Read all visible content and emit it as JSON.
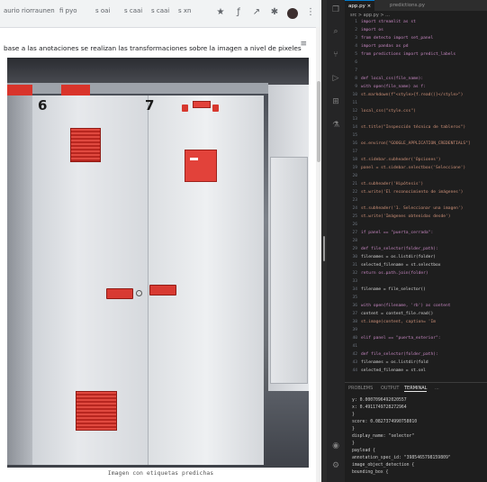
{
  "browser": {
    "bookmarks": [
      "aurio riorraunen",
      "fi pyo",
      "s oai",
      "s caai",
      "s caai",
      "s xn"
    ],
    "toolbar_icons": [
      "star-icon",
      "edit-icon",
      "pen-icon",
      "puzzle-icon",
      "avatar",
      "menu-icon"
    ],
    "description": "base a las anotaciones se realizan las transformaciones sobre la imagen a nivel de pixeles",
    "photo": {
      "label_left": "6",
      "label_right": "7",
      "colors": {
        "cabinet": "#e3e6e9",
        "accent": "#e2423a"
      }
    },
    "caption": "Imagen con etiquetas predichas"
  },
  "vscode": {
    "tabs": [
      "app.py",
      "predictions.py"
    ],
    "breadcrumb": "src > app.py > ...",
    "code_lines": [
      {
        "n": "1",
        "t": "import streamlit as st"
      },
      {
        "n": "2",
        "t": "import os"
      },
      {
        "n": "3",
        "t": "from detecto import set_panel"
      },
      {
        "n": "4",
        "t": "import pandas as pd"
      },
      {
        "n": "5",
        "t": "from predictions import predict_labels"
      },
      {
        "n": "6",
        "t": ""
      },
      {
        "n": "7",
        "t": ""
      },
      {
        "n": "8",
        "t": "def local_css(file_name):"
      },
      {
        "n": "9",
        "t": "    with open(file_name) as f:"
      },
      {
        "n": "10",
        "t": "        st.markdown(f\"<style>{f.read()}</style>\")"
      },
      {
        "n": "11",
        "t": ""
      },
      {
        "n": "12",
        "t": "local_css(\"style.css\")"
      },
      {
        "n": "13",
        "t": ""
      },
      {
        "n": "14",
        "t": "st.title(\"Inspección técnica de tableros\")"
      },
      {
        "n": "15",
        "t": ""
      },
      {
        "n": "16",
        "t": "os.environ[\"GOOGLE_APPLICATION_CREDENTIALS\"]"
      },
      {
        "n": "17",
        "t": ""
      },
      {
        "n": "18",
        "t": "st.sidebar.subheader('Opciones')"
      },
      {
        "n": "19",
        "t": "panel = st.sidebar.selectbox('Seleccione')"
      },
      {
        "n": "20",
        "t": ""
      },
      {
        "n": "21",
        "t": "st.subheader('Hipótesis')"
      },
      {
        "n": "22",
        "t": "st.write('El reconocimiento de imágenes')"
      },
      {
        "n": "23",
        "t": ""
      },
      {
        "n": "24",
        "t": "st.subheader('1. Seleccionar una imagen')"
      },
      {
        "n": "25",
        "t": "st.write('Imágenes obtenidas desde')"
      },
      {
        "n": "26",
        "t": ""
      },
      {
        "n": "27",
        "t": "if panel == \"puerta_cerrada\":"
      },
      {
        "n": "28",
        "t": ""
      },
      {
        "n": "29",
        "t": "    def file_selector(folder_path):"
      },
      {
        "n": "30",
        "t": "        filenames = os.listdir(folder)"
      },
      {
        "n": "31",
        "t": "        selected_filename = st.selectbox"
      },
      {
        "n": "32",
        "t": "        return os.path.join(folder)"
      },
      {
        "n": "33",
        "t": ""
      },
      {
        "n": "34",
        "t": "    filename = file_selector()"
      },
      {
        "n": "35",
        "t": ""
      },
      {
        "n": "36",
        "t": "    with open(filename, 'rb') as content"
      },
      {
        "n": "37",
        "t": "        content = content_file.read()"
      },
      {
        "n": "38",
        "t": "    st.image(content, caption= 'Im"
      },
      {
        "n": "39",
        "t": ""
      },
      {
        "n": "40",
        "t": "elif panel == \"puerta_exterior\":"
      },
      {
        "n": "41",
        "t": ""
      },
      {
        "n": "42",
        "t": "    def file_selector(folder_path):"
      },
      {
        "n": "43",
        "t": "        filenames = os.listdir(fold"
      },
      {
        "n": "44",
        "t": "        selected_filename = st.sel"
      }
    ],
    "panel_tabs": [
      "PROBLEMS",
      "OUTPUT",
      "TERMINAL",
      "..."
    ],
    "terminal_lines": [
      "y: 0.0007096492020557",
      "x: 0.4911749728272964",
      "}",
      "score: 0.0827374990758010",
      "}",
      "display_name: \"selector\"",
      "}",
      "payload {",
      "  annotation_spec_id: \"3985465798159809\"",
      "  image_object_detection {",
      "    bounding_box {"
    ]
  }
}
